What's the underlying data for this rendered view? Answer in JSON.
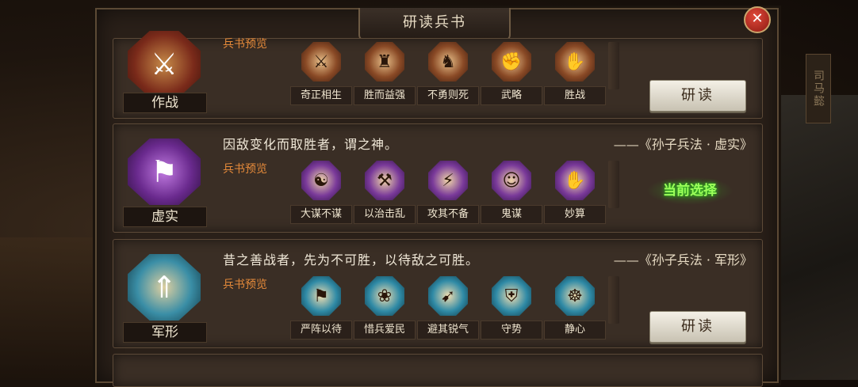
{
  "dialog": {
    "title": "研读兵书",
    "close_label": "✕"
  },
  "background": {
    "banner_text": "司马懿"
  },
  "rows": [
    {
      "id": "zuozhan",
      "name": "作战",
      "emblem_glyph": "⚔",
      "preview_label": "兵书预览",
      "skills": [
        "奇正相生",
        "胜而益强",
        "不勇则死",
        "武略",
        "胜战"
      ],
      "action": "研读"
    },
    {
      "id": "xushi",
      "name": "虚实",
      "emblem_glyph": "⚑",
      "quote": "因敌变化而取胜者，谓之神。",
      "source": "——《孙子兵法 · 虚实》",
      "preview_label": "兵书预览",
      "skills": [
        "大谋不谋",
        "以治击乱",
        "攻其不备",
        "鬼谋",
        "妙算"
      ],
      "status": "当前选择"
    },
    {
      "id": "junxing",
      "name": "军形",
      "emblem_glyph": "⇑",
      "quote": "昔之善战者，先为不可胜，以待敌之可胜。",
      "source": "——《孙子兵法 · 军形》",
      "preview_label": "兵书预览",
      "skills": [
        "严阵以待",
        "惜兵爱民",
        "避其锐气",
        "守势",
        "静心"
      ],
      "action": "研读"
    }
  ]
}
